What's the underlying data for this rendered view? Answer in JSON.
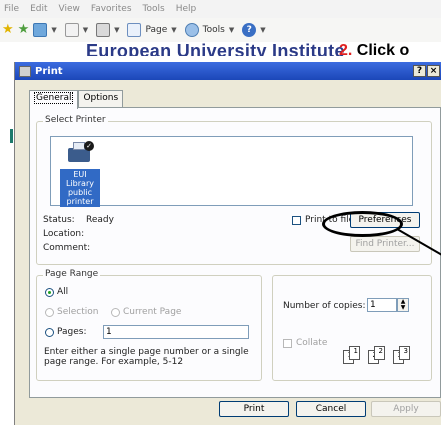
{
  "browser": {
    "menu": [
      "File",
      "Edit",
      "View",
      "Favorites",
      "Tools",
      "Help"
    ],
    "toolbar": {
      "page_label": "Page",
      "tools_label": "Tools"
    },
    "site_title": "European University Institute",
    "step_number": "2.",
    "step_text": "Click o"
  },
  "dialog": {
    "title": "Print",
    "help_button": "?",
    "close_button": "×",
    "tabs": [
      {
        "label": "General",
        "active": true
      },
      {
        "label": "Options",
        "active": false
      }
    ],
    "select_printer": {
      "group_label": "Select Printer",
      "printer_name": "EUI Library public printer",
      "status_label": "Status:",
      "status_value": "Ready",
      "location_label": "Location:",
      "comment_label": "Comment:",
      "print_to_file_label": "Print to file",
      "preferences_button": "Preferences",
      "find_printer_button": "Find Printer..."
    },
    "page_range": {
      "group_label": "Page Range",
      "all_label": "All",
      "selection_label": "Selection",
      "current_page_label": "Current Page",
      "pages_label": "Pages:",
      "pages_value": "1",
      "hint": "Enter either a single page number or a single page range.  For example, 5-12"
    },
    "copies": {
      "number_label": "Number of copies:",
      "number_value": "1",
      "collate_label": "Collate",
      "collate_pages": [
        "1",
        "1",
        "2",
        "2",
        "3",
        "3"
      ]
    },
    "buttons": {
      "print": "Print",
      "cancel": "Cancel",
      "apply": "Apply"
    }
  }
}
